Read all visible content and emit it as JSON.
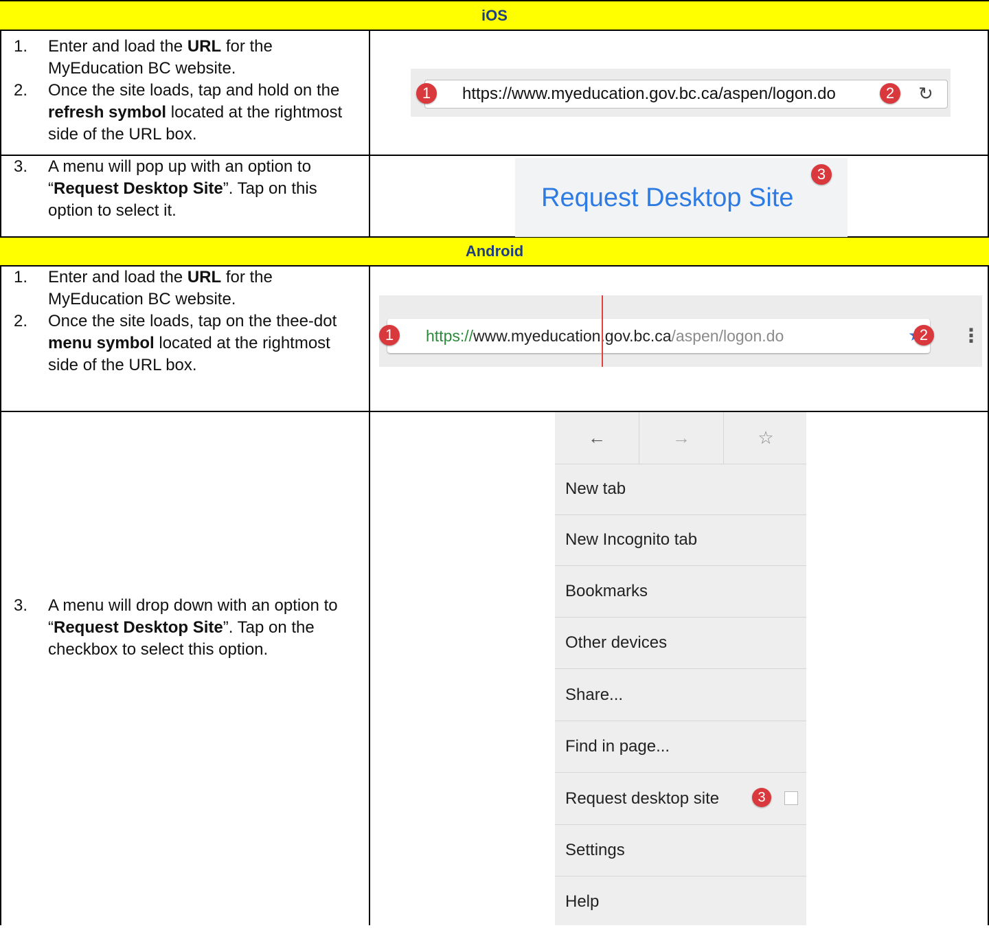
{
  "ios": {
    "header": "iOS",
    "steps_a": [
      {
        "num": "1.",
        "pre": "Enter and load the ",
        "bold": "URL",
        "post": " for the MyEducation BC website."
      },
      {
        "num": "2.",
        "pre": "Once the site loads, tap and hold on the ",
        "bold": "refresh symbol",
        "post": " located at the rightmost side of the URL box."
      }
    ],
    "steps_b": [
      {
        "num": "3.",
        "pre": "A menu will pop up with an option to “",
        "bold": "Request Desktop Site",
        "post": "”.  Tap on this option to select it."
      }
    ],
    "url": "https://www.myeducation.gov.bc.ca/aspen/logon.do",
    "badge1": "1",
    "badge2": "2",
    "badge3": "3",
    "refresh_icon": "refresh-icon",
    "request_label": "Request Desktop Site"
  },
  "android": {
    "header": "Android",
    "steps_a": [
      {
        "num": "1.",
        "pre": "Enter and load the ",
        "bold": "URL",
        "post": " for the MyEducation BC website."
      },
      {
        "num": "2.",
        "pre": "Once the site loads, tap on the thee-dot ",
        "bold": "menu symbol",
        "post": " located at the rightmost side of the URL box."
      }
    ],
    "steps_b": [
      {
        "num": "3.",
        "pre": "A menu will drop down with an option to “",
        "bold": "Request Desktop Site",
        "post": "”. Tap on the checkbox to select this option."
      }
    ],
    "url_scheme": "https://",
    "url_domain": "www.myeducation.gov.bc.ca",
    "url_path": "/aspen/logon.do",
    "badge1": "1",
    "badge2": "2",
    "badge3": "3",
    "nav_icons": [
      "←",
      "→",
      "☆"
    ],
    "menu_items": [
      "New tab",
      "New Incognito tab",
      "Bookmarks",
      "Other devices",
      "Share...",
      "Find in page...",
      "Request desktop site",
      "Settings",
      "Help"
    ]
  }
}
